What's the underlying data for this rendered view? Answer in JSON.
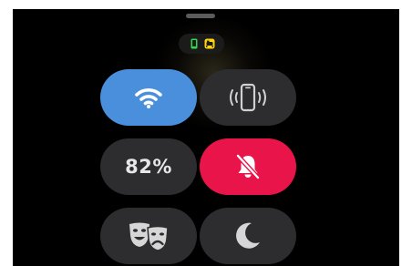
{
  "control_center": {
    "status_icons": [
      "phone-connected-icon",
      "sleep-mode-icon"
    ],
    "tiles": [
      {
        "id": "wifi",
        "icon": "wifi-icon",
        "state": "on",
        "color": "#4a8fdc"
      },
      {
        "id": "ping-iphone",
        "icon": "ping-iphone-icon",
        "state": "off"
      },
      {
        "id": "battery",
        "label": "82%"
      },
      {
        "id": "silent-mode",
        "icon": "bell-slash-icon",
        "state": "on",
        "color": "#e8144a"
      },
      {
        "id": "theater-mode",
        "icon": "theater-masks-icon",
        "state": "off"
      },
      {
        "id": "do-not-disturb",
        "icon": "moon-icon",
        "state": "off"
      }
    ]
  }
}
